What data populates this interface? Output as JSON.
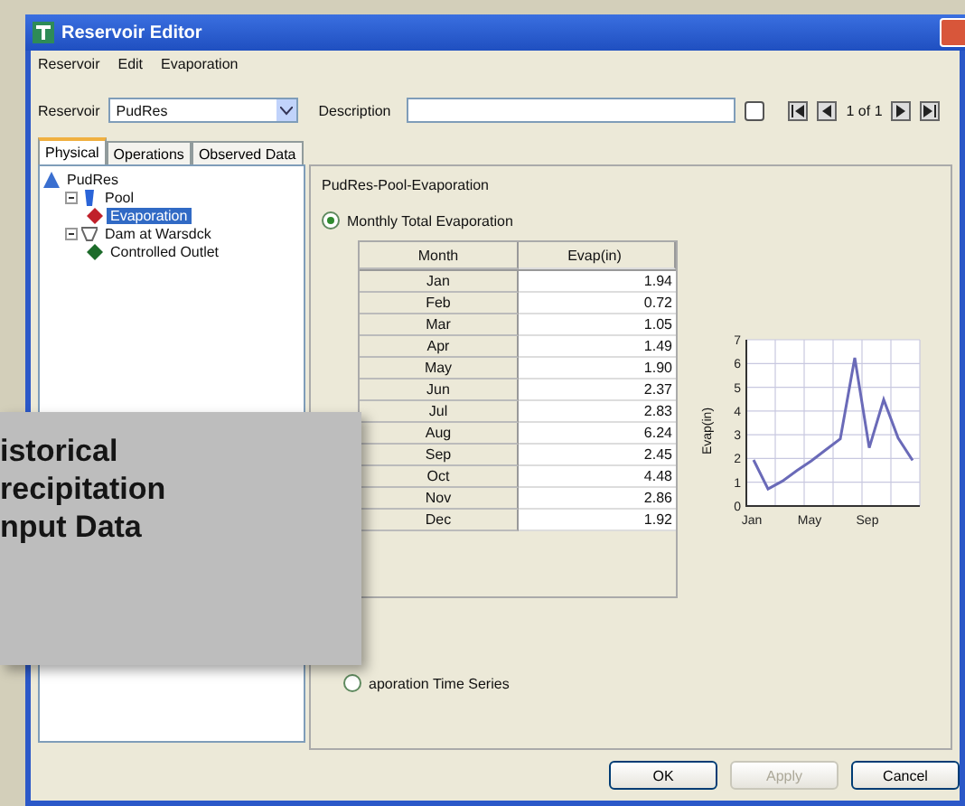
{
  "window": {
    "title": "Reservoir Editor"
  },
  "menu": [
    "Reservoir",
    "Edit",
    "Evaporation"
  ],
  "toolbar": {
    "reservoir_label": "Reservoir",
    "reservoir_value": "PudRes",
    "description_label": "Description",
    "record_position": "1 of 1"
  },
  "tabs": [
    {
      "label": "Physical",
      "selected": true
    },
    {
      "label": "Operations",
      "selected": false
    },
    {
      "label": "Observed Data",
      "selected": false
    }
  ],
  "tree": [
    {
      "label": "PudRes",
      "kind": "reservoir",
      "selected": false,
      "children": [
        {
          "label": "Pool",
          "kind": "pool",
          "selected": false,
          "expanded": true,
          "children": [
            {
              "label": "Evaporation",
              "kind": "evaporation",
              "selected": true
            }
          ]
        },
        {
          "label": "Dam at Warsdck",
          "kind": "dam",
          "selected": false,
          "expanded": true,
          "children": [
            {
              "label": "Controlled Outlet",
              "kind": "outlet",
              "selected": false
            }
          ]
        }
      ]
    }
  ],
  "panel_title": "PudRes-Pool-Evaporation",
  "options": [
    {
      "label": "Monthly Total Evaporation",
      "selected": true
    },
    {
      "label": "aporation Time Series",
      "selected": false
    }
  ],
  "table": {
    "columns": [
      "Month",
      "Evap(in)"
    ],
    "rows": [
      [
        "Jan",
        "1.94"
      ],
      [
        "Feb",
        "0.72"
      ],
      [
        "Mar",
        "1.05"
      ],
      [
        "Apr",
        "1.49"
      ],
      [
        "May",
        "1.90"
      ],
      [
        "Jun",
        "2.37"
      ],
      [
        "Jul",
        "2.83"
      ],
      [
        "Aug",
        "6.24"
      ],
      [
        "Sep",
        "2.45"
      ],
      [
        "Oct",
        "4.48"
      ],
      [
        "Nov",
        "2.86"
      ],
      [
        "Dec",
        "1.92"
      ]
    ]
  },
  "chart_data": {
    "type": "line",
    "ylabel": "Evap(in)",
    "grid": true,
    "categories": [
      "Jan",
      null,
      null,
      null,
      "May",
      null,
      null,
      null,
      "Sep",
      null,
      null,
      null
    ],
    "series": [
      {
        "color": "#6a6ab8",
        "values": [
          1.94,
          0.72,
          1.05,
          1.49,
          1.9,
          2.37,
          2.83,
          6.24,
          2.45,
          4.48,
          2.86,
          1.92
        ]
      }
    ],
    "ylim": [
      0,
      7
    ],
    "yticks": [
      0,
      1,
      2,
      3,
      4,
      5,
      6,
      7
    ]
  },
  "buttons": [
    {
      "label": "OK",
      "disabled": false
    },
    {
      "label": "Apply",
      "disabled": true
    },
    {
      "label": "Cancel",
      "disabled": false
    }
  ],
  "overlay": {
    "lines": [
      "istorical",
      "recipitation",
      "nput Data"
    ]
  }
}
